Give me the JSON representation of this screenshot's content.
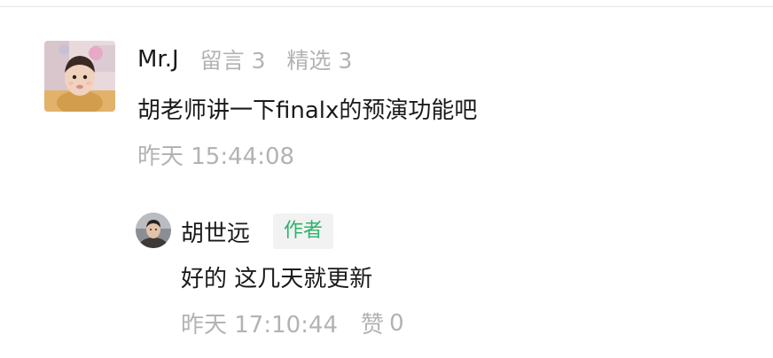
{
  "comment": {
    "user_name": "Mr.J",
    "messages_stat": "留言 3",
    "featured_stat": "精选 3",
    "text": "胡老师讲一下finalx的预演功能吧",
    "time": "昨天 15:44:08"
  },
  "reply": {
    "user_name": "胡世远",
    "author_badge": "作者",
    "text": "好的 这几天就更新",
    "time": "昨天 17:10:44",
    "like_label": "赞",
    "like_count": "0"
  },
  "colors": {
    "primary_text": "#1a1a1a",
    "secondary_text": "#b3b3b3",
    "author_badge_text": "#2bb46b",
    "author_badge_bg": "#f2f2f2",
    "divider": "#e6e6e6"
  },
  "icons": {
    "commenter_avatar": "child-photo-avatar",
    "author_avatar": "author-photo-avatar"
  }
}
